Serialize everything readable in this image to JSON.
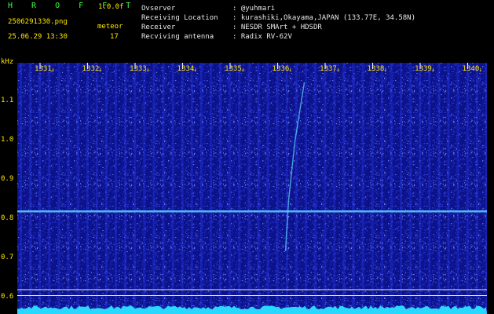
{
  "header": {
    "app_name": "H R O F F T",
    "version": "1.0.0f",
    "filename": "2506291330.png",
    "datetime": "25.06.29 13:30",
    "category_label": "meteor",
    "count": "17",
    "info": [
      {
        "label": "Ovserver",
        "value": ": @yuhmari"
      },
      {
        "label": "Receiving Location",
        "value": ": kurashiki,Okayama,JAPAN (133.77E, 34.58N)"
      },
      {
        "label": "Receiver",
        "value": ": NESDR SMArt + HDSDR"
      },
      {
        "label": "Recviving antenna",
        "value": ": Radix RV-62V"
      }
    ]
  },
  "colors": {
    "background": "#000000",
    "label_yellow": "#ffe600",
    "title_green": "#3cff3c",
    "waterfall_blue": "#1420c8",
    "signal_cyan": "#30e8ff"
  },
  "chart_data": {
    "type": "heatmap",
    "ylabel": "kHz",
    "y_ticks": [
      "1.1",
      "1.0",
      "0.9",
      "0.8",
      "0.7",
      "0.6"
    ],
    "y_values": [
      1.1,
      1.0,
      0.9,
      0.8,
      0.7,
      0.6
    ],
    "x_ticks": [
      "1331",
      "1332",
      "1333",
      "1334",
      "1335",
      "1336",
      "1337",
      "1338",
      "1339",
      "1340"
    ],
    "x_values": [
      1331,
      1332,
      1333,
      1334,
      1335,
      1336,
      1337,
      1338,
      1339,
      1340
    ],
    "carrier_khz": 0.82,
    "reference_lines_khz": [
      0.62,
      0.605
    ]
  }
}
